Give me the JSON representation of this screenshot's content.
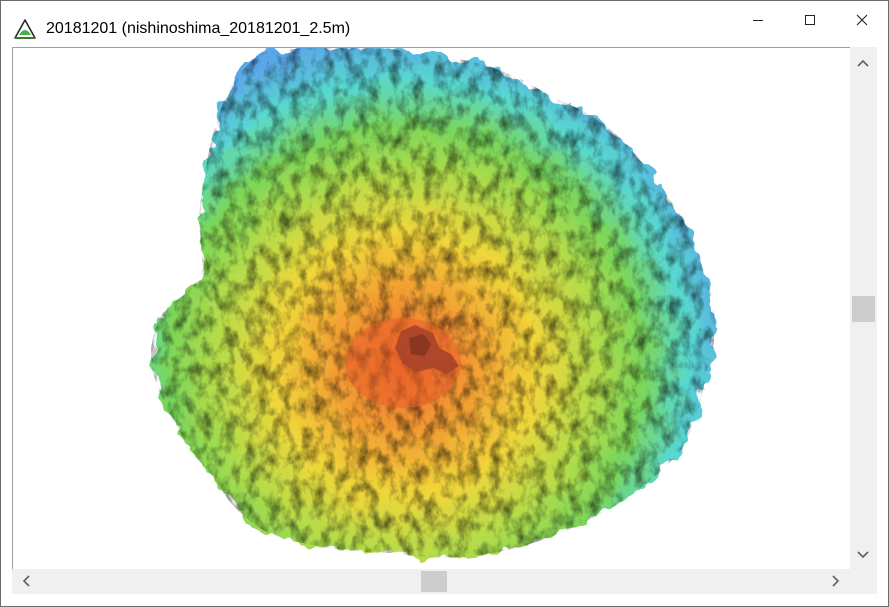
{
  "window": {
    "title": "20181201 (nishinoshima_20181201_2.5m)",
    "icon": "triangle-landform-icon",
    "controls": [
      "minimize-icon",
      "maximize-icon",
      "close-icon"
    ]
  },
  "map": {
    "subject": "elevation relief map",
    "colors": {
      "low": "#5aa6e8",
      "cyan": "#58d8d0",
      "green": "#7ad65a",
      "yellow": "#f0d63a",
      "orange": "#f29a32",
      "high": "#ef6a2a"
    }
  },
  "scrollbars": {
    "vertical": {
      "position": 0.5,
      "up": "chevron-up-icon",
      "down": "chevron-down-icon"
    },
    "horizontal": {
      "position": 0.5,
      "left": "chevron-left-icon",
      "right": "chevron-right-icon"
    }
  }
}
